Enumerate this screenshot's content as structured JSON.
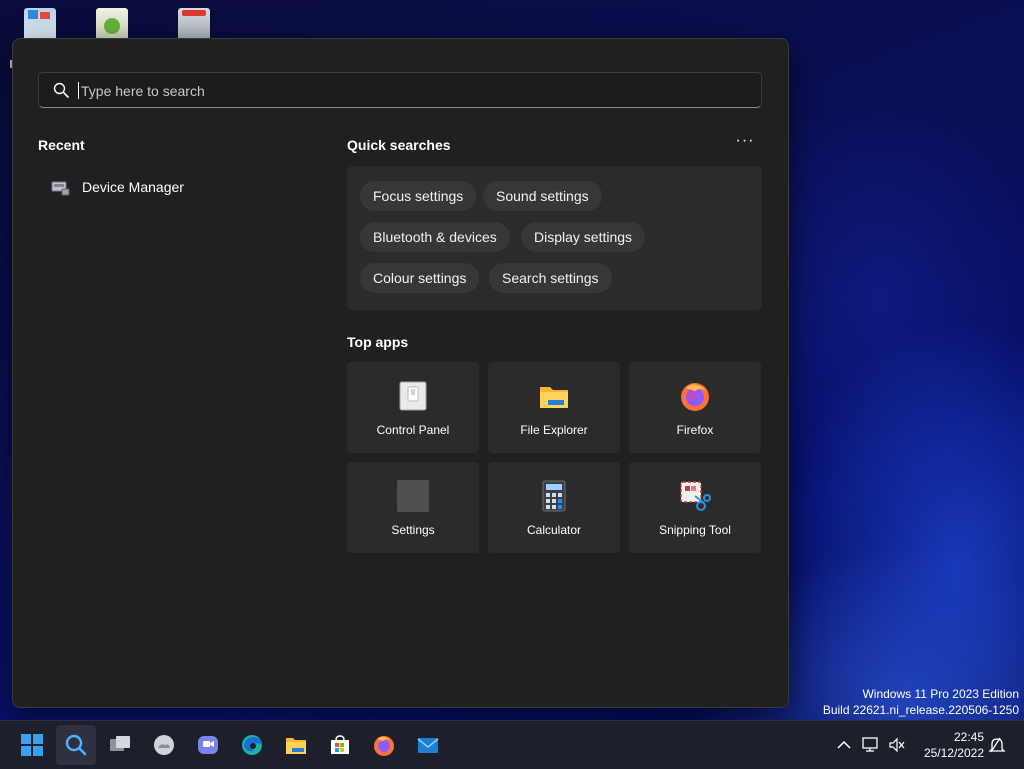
{
  "search": {
    "placeholder": "Type here to search",
    "value": ""
  },
  "recent": {
    "title": "Recent",
    "items": [
      {
        "label": "Device Manager",
        "icon": "device-manager-icon"
      }
    ]
  },
  "quick_searches": {
    "title": "Quick searches",
    "more_label": "···",
    "chips": [
      {
        "label": "Focus settings"
      },
      {
        "label": "Sound settings"
      },
      {
        "label": "Bluetooth & devices"
      },
      {
        "label": "Display settings"
      },
      {
        "label": "Colour settings"
      },
      {
        "label": "Search settings"
      }
    ]
  },
  "top_apps": {
    "title": "Top apps",
    "apps": [
      {
        "label": "Control Panel",
        "icon": "control-panel-icon"
      },
      {
        "label": "File Explorer",
        "icon": "file-explorer-icon"
      },
      {
        "label": "Firefox",
        "icon": "firefox-icon"
      },
      {
        "label": "Settings",
        "icon": "settings-icon"
      },
      {
        "label": "Calculator",
        "icon": "calculator-icon"
      },
      {
        "label": "Snipping Tool",
        "icon": "snipping-tool-icon"
      }
    ]
  },
  "watermark": {
    "line1": "Windows 11 Pro 2023 Edition",
    "line2": "Build 22621.ni_release.220506-1250"
  },
  "taskbar": {
    "buttons": [
      {
        "name": "start-icon"
      },
      {
        "name": "search-icon",
        "active": true
      },
      {
        "name": "task-view-icon"
      },
      {
        "name": "widgets-icon"
      },
      {
        "name": "teams-chat-icon"
      },
      {
        "name": "edge-icon"
      },
      {
        "name": "file-explorer-icon"
      },
      {
        "name": "microsoft-store-icon"
      },
      {
        "name": "firefox-icon"
      },
      {
        "name": "mail-icon"
      }
    ],
    "clock": {
      "time": "22:45",
      "date": "25/12/2022"
    }
  },
  "colors": {
    "panel_bg": "#202020",
    "tile_bg": "#2b2b2b",
    "chip_bg": "#373737",
    "accent": "#0078d4"
  }
}
